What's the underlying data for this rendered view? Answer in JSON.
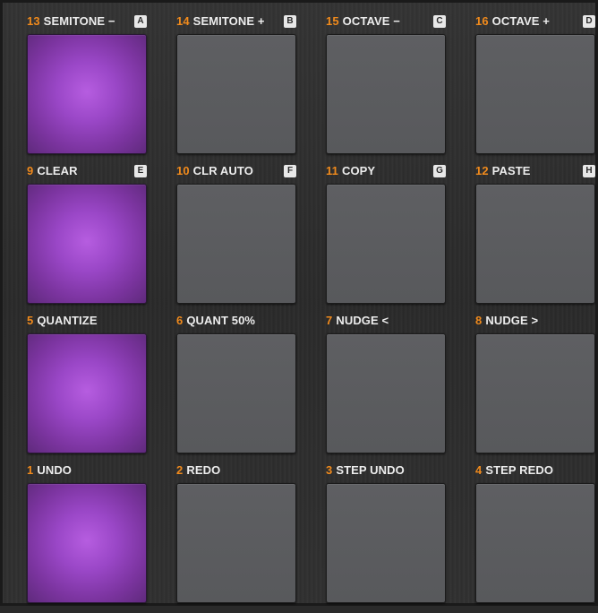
{
  "colors": {
    "pad_unlit": "#5e5f62",
    "pad_lit": "#a64fd1",
    "number_accent": "#f08a1c",
    "label_text": "#ededed",
    "panel_background": "#2c2c2c"
  },
  "pads": [
    {
      "number": "13",
      "label": "SEMITONE −",
      "key": "A",
      "lit": true
    },
    {
      "number": "14",
      "label": "SEMITONE +",
      "key": "B",
      "lit": false
    },
    {
      "number": "15",
      "label": "OCTAVE −",
      "key": "C",
      "lit": false
    },
    {
      "number": "16",
      "label": "OCTAVE +",
      "key": "D",
      "lit": false
    },
    {
      "number": "9",
      "label": "CLEAR",
      "key": "E",
      "lit": true
    },
    {
      "number": "10",
      "label": "CLR AUTO",
      "key": "F",
      "lit": false
    },
    {
      "number": "11",
      "label": "COPY",
      "key": "G",
      "lit": false
    },
    {
      "number": "12",
      "label": "PASTE",
      "key": "H",
      "lit": false
    },
    {
      "number": "5",
      "label": "QUANTIZE",
      "key": "",
      "lit": true
    },
    {
      "number": "6",
      "label": "QUANT 50%",
      "key": "",
      "lit": false
    },
    {
      "number": "7",
      "label": "NUDGE <",
      "key": "",
      "lit": false
    },
    {
      "number": "8",
      "label": "NUDGE >",
      "key": "",
      "lit": false
    },
    {
      "number": "1",
      "label": "UNDO",
      "key": "",
      "lit": true
    },
    {
      "number": "2",
      "label": "REDO",
      "key": "",
      "lit": false
    },
    {
      "number": "3",
      "label": "STEP UNDO",
      "key": "",
      "lit": false
    },
    {
      "number": "4",
      "label": "STEP REDO",
      "key": "",
      "lit": false
    }
  ]
}
